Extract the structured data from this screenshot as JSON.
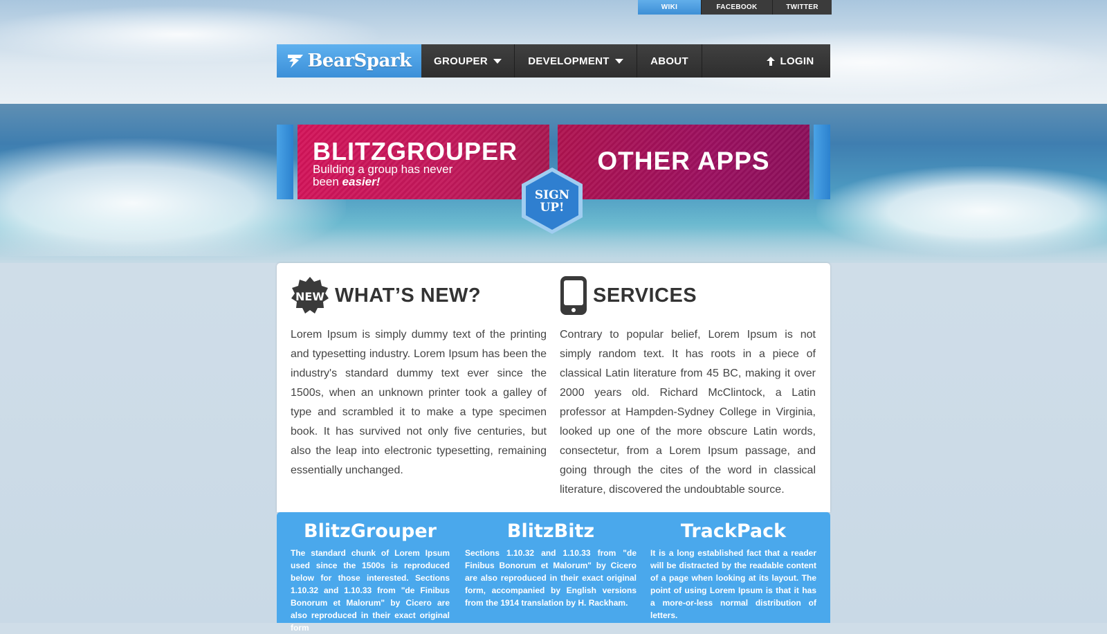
{
  "social": {
    "wiki": "WIKI",
    "facebook": "FACEBOOK",
    "twitter": "TWITTER"
  },
  "nav": {
    "logo": "BearSpark",
    "items": [
      "GROUPER",
      "DEVELOPMENT",
      "ABOUT"
    ],
    "login": "LOGIN"
  },
  "banner": {
    "blitz_title": "BLITZGROUPER",
    "blitz_sub_1": "Building a group has never been ",
    "blitz_sub_em": "easier!",
    "other_title": "OTHER APPS",
    "signup_line1": "SIGN",
    "signup_line2": "UP!"
  },
  "whats_new": {
    "badge": "NEW",
    "title": "WHAT’S NEW?",
    "body": "Lorem Ipsum is simply dummy text of the printing and typesetting industry. Lorem Ipsum has been the industry's standard dummy text ever since the 1500s, when an unknown printer took a galley of type and scrambled it to make a type specimen book. It has survived not only five centuries, but also the leap into electronic typesetting, remaining essentially unchanged."
  },
  "services": {
    "title": "SERVICES",
    "body": "Contrary to popular belief, Lorem Ipsum is not simply random text. It has roots in a piece of classical Latin literature from 45 BC, making it over 2000 years old. Richard McClintock, a Latin professor at Hampden-Sydney College in Virginia, looked up one of the more obscure Latin words, consectetur, from a Lorem Ipsum passage, and going through the cites of the word in classical literature, discovered the undoubtable source."
  },
  "apps": [
    {
      "name": "BlitzGrouper",
      "body": "The standard chunk of Lorem Ipsum used since the 1500s is reproduced below for those interested. Sections 1.10.32 and 1.10.33 from \"de Finibus Bonorum et Malorum\" by Cicero are also reproduced in their exact original form"
    },
    {
      "name": "BlitzBitz",
      "body": "Sections 1.10.32 and 1.10.33 from \"de Finibus Bonorum et Malorum\" by Cicero are also reproduced in their exact original form, accompanied by English versions from the 1914 translation by H. Rackham."
    },
    {
      "name": "TrackPack",
      "body": "It is a long established fact that a reader will be distracted by the readable content of a page when looking at its layout. The point of using Lorem Ipsum is that it has a more-or-less normal distribution of letters."
    }
  ],
  "colors": {
    "accent_blue": "#4aa8ec",
    "nav_dark": "#333333",
    "banner_pink": "#d4145a",
    "banner_magenta": "#9c1060",
    "hex_blue": "#2f7fd0"
  },
  "icons": {
    "logo": "lightning-bolt-icon",
    "dropdown": "chevron-down-icon",
    "login": "arrow-up-icon",
    "new": "new-badge-icon",
    "services": "smartphone-icon",
    "signup": "hexagon-icon"
  }
}
